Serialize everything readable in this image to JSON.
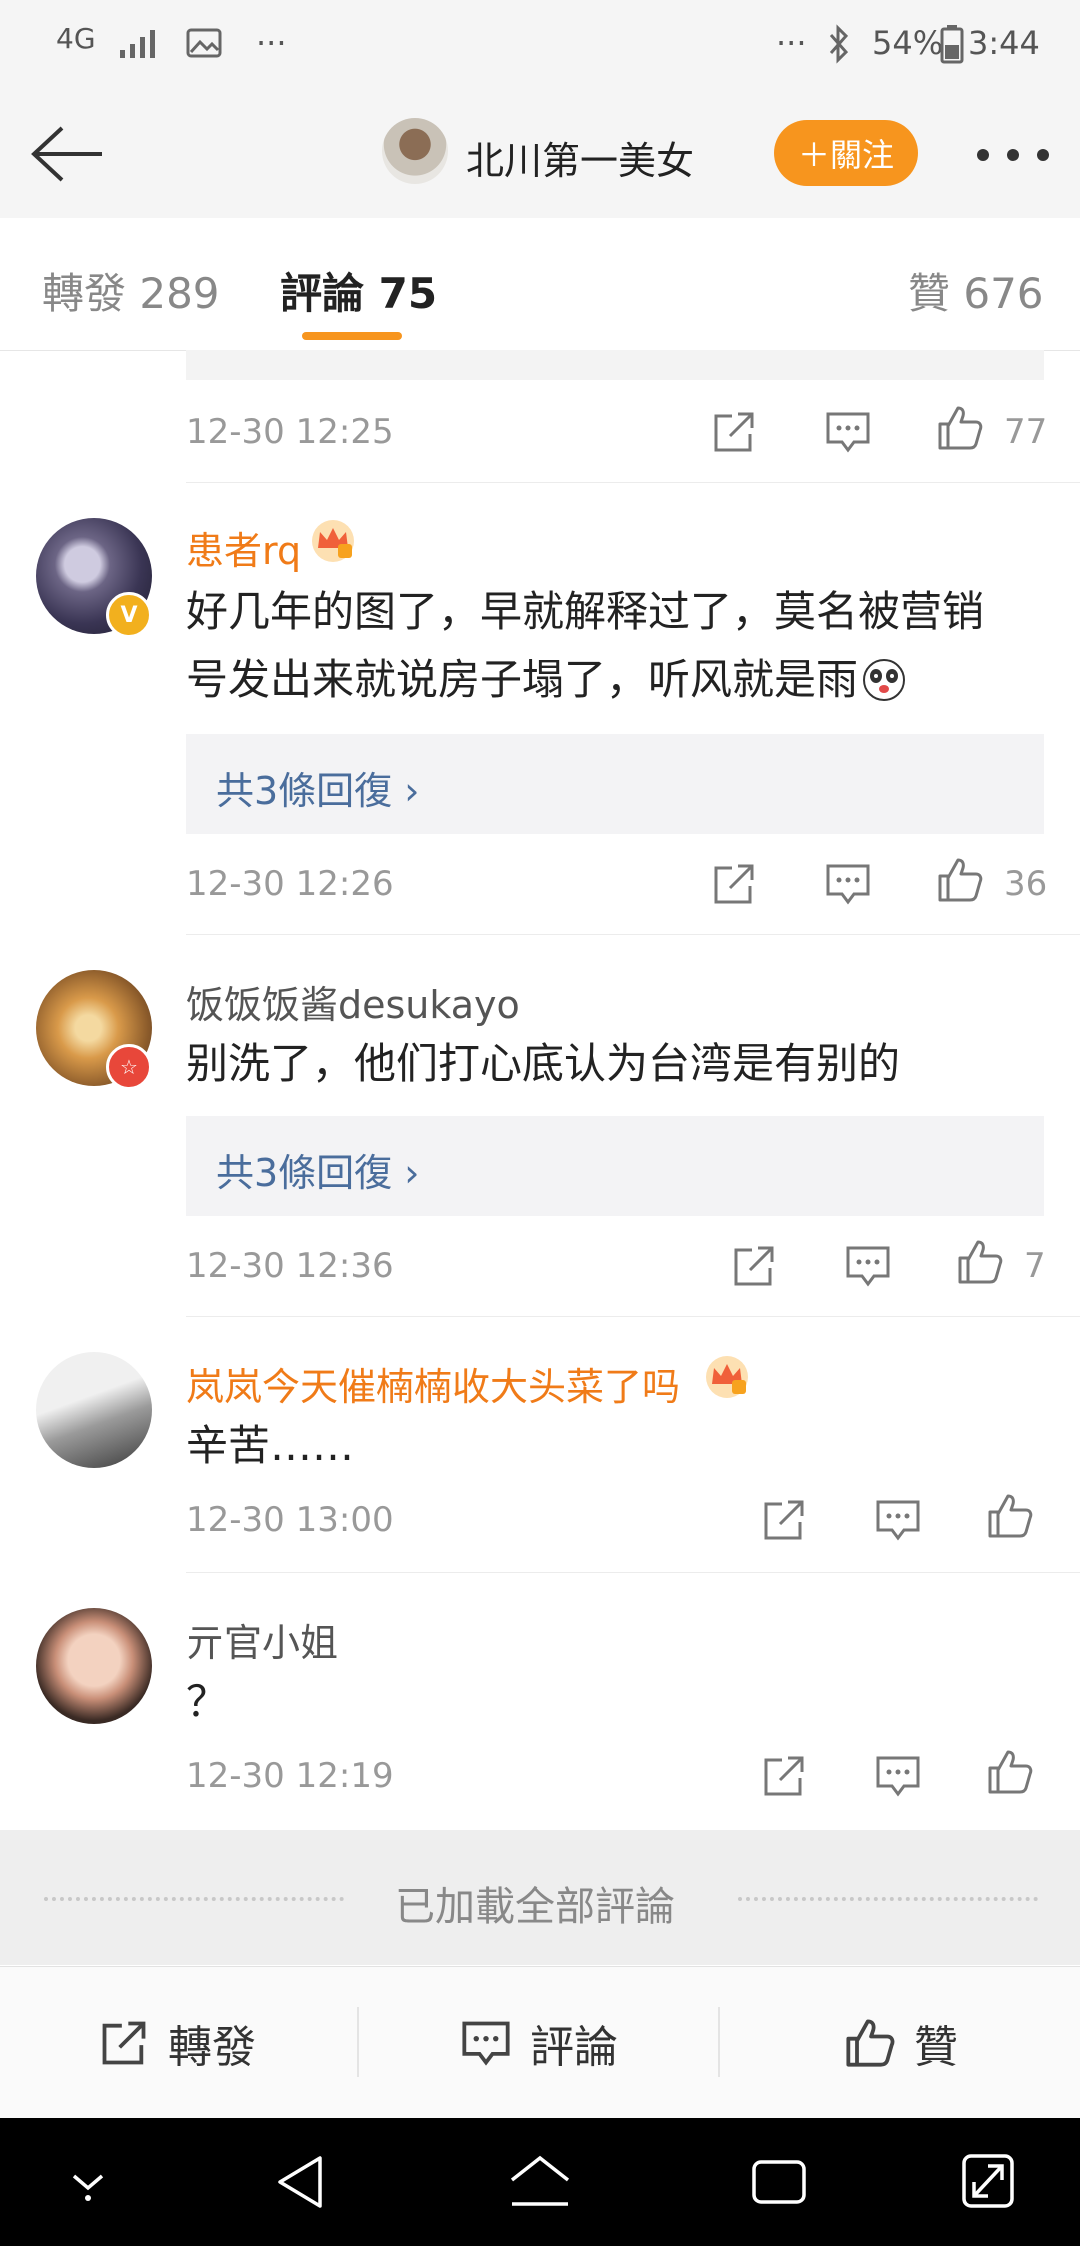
{
  "status_bar": {
    "network": "4G",
    "more_left": "···",
    "more_right": "···",
    "battery": "54%",
    "time": "3:44"
  },
  "header": {
    "title": "北川第一美女",
    "follow_label": "＋關注"
  },
  "tabs": {
    "repost": "轉發 289",
    "comments": "評論 75",
    "likes": "贊 676"
  },
  "comments": [
    {
      "time": "12-30 12:25",
      "likes": "77"
    },
    {
      "username": "患者rq",
      "content_line1": "好几年的图了，早就解释过了，莫名被营销",
      "content_line2": "号发出来就说房子塌了，听风就是雨",
      "reply_label": "共3條回復 ›",
      "time": "12-30 12:26",
      "likes": "36"
    },
    {
      "username": "饭饭饭酱desukayo",
      "content": "别洗了，他们打心底认为台湾是有别的",
      "reply_label": "共3條回復 ›",
      "time": "12-30 12:36",
      "likes": "7"
    },
    {
      "username": "岚岚今天催楠楠收大头菜了吗",
      "content": "辛苦……",
      "time": "12-30 13:00"
    },
    {
      "username": "亓官小姐",
      "content": "？",
      "time": "12-30 12:19"
    }
  ],
  "footer_text": "已加載全部評論",
  "bottom_bar": {
    "repost": "轉發",
    "comment": "評論",
    "like": "贊"
  },
  "colors": {
    "accent": "#f7951e",
    "username_vip": "#f07b18",
    "reply_link": "#4a6d9c"
  }
}
